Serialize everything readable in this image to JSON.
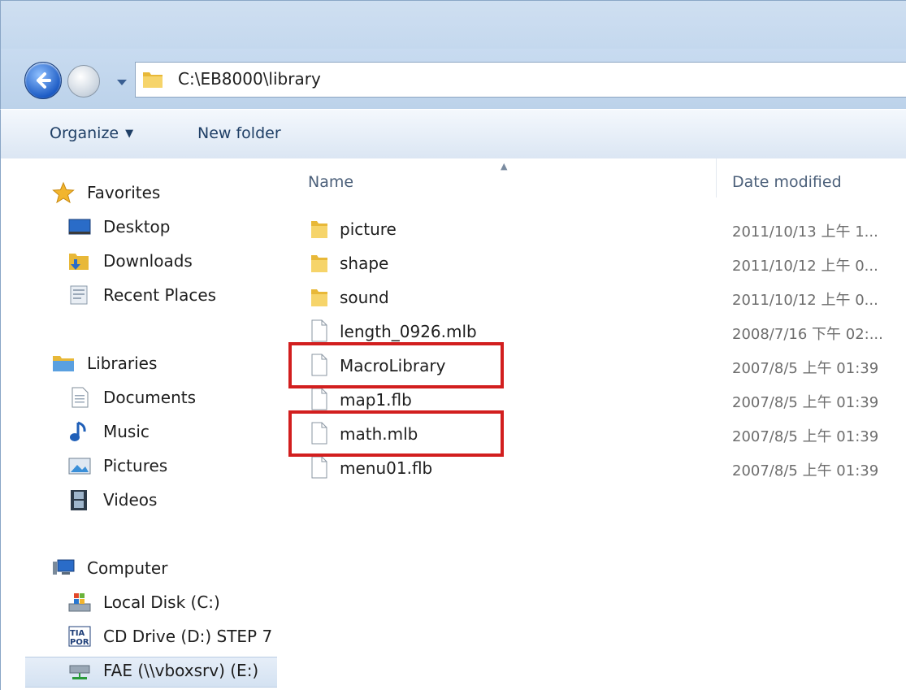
{
  "address": {
    "path": "C:\\EB8000\\library"
  },
  "toolbar": {
    "organize_label": "Organize",
    "new_folder_label": "New folder"
  },
  "columns": {
    "name": "Name",
    "date_modified": "Date modified"
  },
  "nav": {
    "favorites": {
      "label": "Favorites",
      "items": [
        "Desktop",
        "Downloads",
        "Recent Places"
      ]
    },
    "libraries": {
      "label": "Libraries",
      "items": [
        "Documents",
        "Music",
        "Pictures",
        "Videos"
      ]
    },
    "computer": {
      "label": "Computer",
      "items": [
        "Local Disk (C:)",
        "CD Drive (D:) STEP 7",
        "FAE (\\\\vboxsrv) (E:)"
      ]
    }
  },
  "files": [
    {
      "name": "picture",
      "date": "2011/10/13 上午 1...",
      "type": "folder"
    },
    {
      "name": "shape",
      "date": "2011/10/12 上午 0...",
      "type": "folder"
    },
    {
      "name": "sound",
      "date": "2011/10/12 上午 0...",
      "type": "folder"
    },
    {
      "name": "length_0926.mlb",
      "date": "2008/7/16 下午 02:...",
      "type": "file"
    },
    {
      "name": "MacroLibrary",
      "date": "2007/8/5 上午 01:39",
      "type": "file",
      "highlighted": true
    },
    {
      "name": "map1.flb",
      "date": "2007/8/5 上午 01:39",
      "type": "file"
    },
    {
      "name": "math.mlb",
      "date": "2007/8/5 上午 01:39",
      "type": "file",
      "highlighted": true
    },
    {
      "name": "menu01.flb",
      "date": "2007/8/5 上午 01:39",
      "type": "file"
    }
  ],
  "colors": {
    "highlight": "#d21e1e",
    "selection": "#d4e2f2"
  },
  "icons": {
    "nav": [
      "star-icon",
      "desktop-icon",
      "downloads-icon",
      "recent-places-icon",
      "libraries-icon",
      "documents-icon",
      "music-icon",
      "pictures-icon",
      "videos-icon",
      "computer-icon",
      "local-disk-icon",
      "cd-drive-icon",
      "network-drive-icon"
    ]
  }
}
